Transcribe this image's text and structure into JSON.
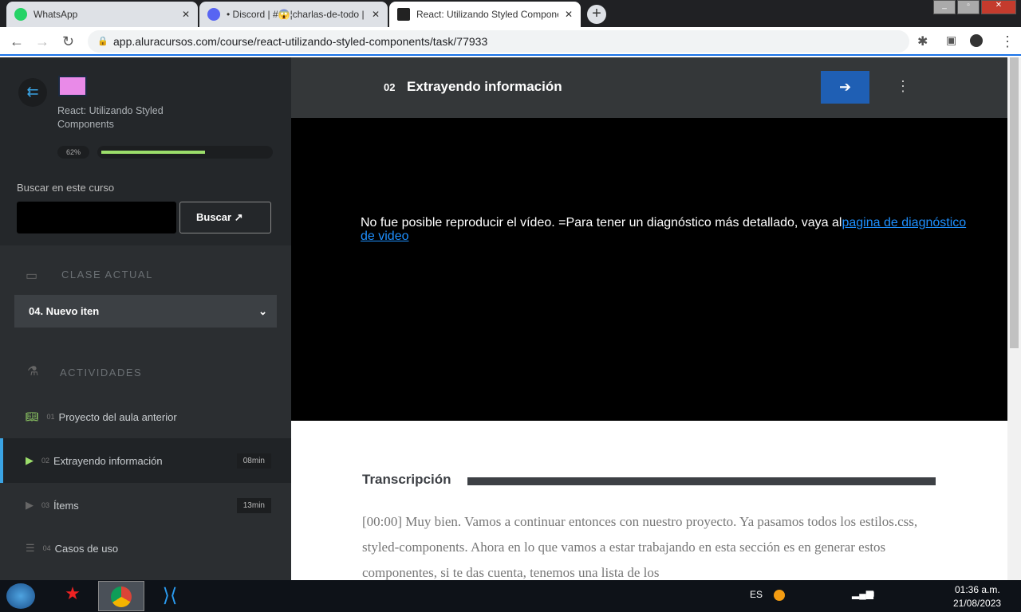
{
  "browser": {
    "tabs": [
      {
        "label": "WhatsApp",
        "icon": "whatsapp-icon"
      },
      {
        "label": "• Discord | #😱¦charlas-de-todo |",
        "icon": "discord-icon"
      },
      {
        "label": "React: Utilizando Styled Compone",
        "icon": "alura-icon",
        "active": true
      }
    ],
    "close": "✕",
    "new_tab": "+",
    "url": "app.aluracursos.com/course/react-utilizando-styled-components/task/77933"
  },
  "sidebar": {
    "course_title": "React: Utilizando Styled Components",
    "progress_label": "62%",
    "progress": 0.62,
    "progress_color": "#9cde6b",
    "search_label": "Buscar en este curso",
    "search_value": "",
    "search_button": "Buscar",
    "current_section": "Clase actual",
    "current_lesson": "04. Nuevo iten",
    "activities_section": "Actividades",
    "items": [
      {
        "num": "01",
        "label": "Proyecto del aula anterior",
        "icon": "book-icon",
        "duration": ""
      },
      {
        "num": "02",
        "label": "Extrayendo información",
        "icon": "play-icon",
        "duration": "08min",
        "active": true
      },
      {
        "num": "03",
        "label": "Ítems",
        "icon": "play-icon",
        "duration": "13min"
      },
      {
        "num": "04",
        "label": "Casos de uso",
        "icon": "list-icon",
        "duration": ""
      }
    ]
  },
  "main": {
    "lesson_num": "02",
    "lesson_title": "Extrayendo información",
    "video_error": "No fue posible reproducir el vídeo. =Para tener un diagnóstico más detallado, vaya al",
    "video_link": "pagina de diagnóstico de video",
    "transcript_title": "Transcripción",
    "transcript": "[00:00] Muy bien. Vamos a continuar entonces con nuestro proyecto. Ya pasamos todos los estilos.css, styled-components. Ahora en lo que vamos a estar trabajando en esta sección es en generar estos componentes, si te das cuenta, tenemos una lista de los"
  },
  "taskbar": {
    "lang": "ES",
    "time": "01:36 a.m.",
    "date": "21/08/2023"
  }
}
